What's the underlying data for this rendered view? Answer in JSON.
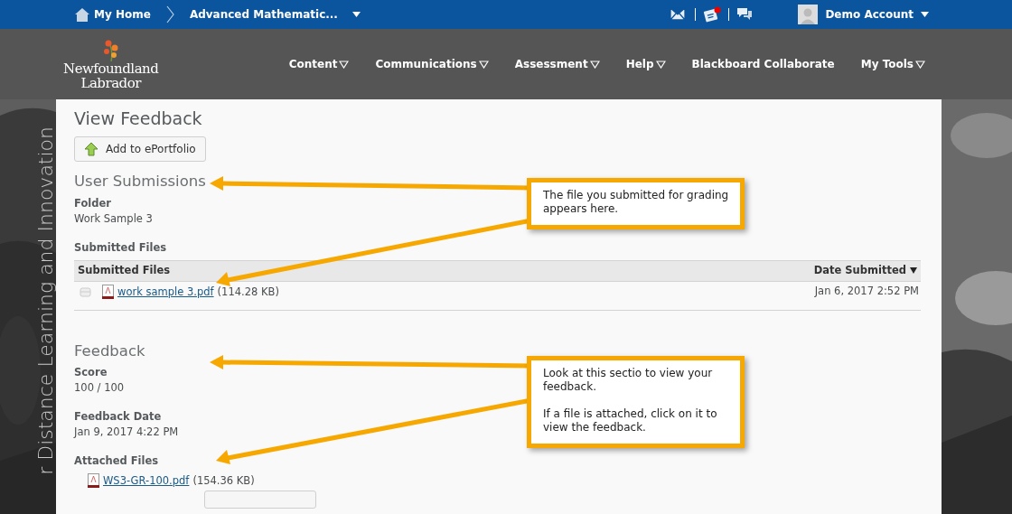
{
  "top_bar": {
    "home": "My Home",
    "course": "Advanced Mathematic...",
    "alerts": [
      {
        "kind": "mail",
        "unread": false
      },
      {
        "kind": "updates",
        "unread": true
      },
      {
        "kind": "chat",
        "unread": false
      }
    ],
    "account": "Demo Account"
  },
  "header": {
    "logo": [
      "Newfoundland",
      "Labrador"
    ],
    "nav": [
      {
        "label": "Content",
        "dropdown": true
      },
      {
        "label": "Communications",
        "dropdown": true
      },
      {
        "label": "Assessment",
        "dropdown": true
      },
      {
        "label": "Help",
        "dropdown": true
      },
      {
        "label": "Blackboard Collaborate",
        "dropdown": false
      },
      {
        "label": "My Tools",
        "dropdown": true
      }
    ]
  },
  "side_text": "r Distance Learning and Innovation",
  "page": {
    "title": "View Feedback",
    "portfolio_button": "Add to ePortfolio",
    "submissions": {
      "heading": "User Submissions",
      "folder_label": "Folder",
      "folder": "Work Sample 3",
      "files_label": "Submitted Files",
      "table": {
        "columns": [
          {
            "label": "Submitted Files",
            "sorted": false
          },
          {
            "label": "Date Submitted",
            "sorted": true
          }
        ],
        "rows": [
          {
            "file": "work sample 3.pdf",
            "size": "(114.28 KB)",
            "date": "Jan 6, 2017 2:52 PM"
          }
        ]
      }
    },
    "feedback": {
      "heading": "Feedback",
      "fields": [
        {
          "label": "Score",
          "value": "100 / 100"
        },
        {
          "label": "Feedback Date",
          "value": "Jan 9, 2017 4:22 PM"
        }
      ],
      "attached_label": "Attached Files",
      "files": [
        {
          "file": "WS3-GR-100.pdf",
          "size": "(154.36 KB)"
        }
      ]
    }
  },
  "callouts": [
    {
      "paragraphs": [
        "The file you submitted for grading appears here."
      ]
    },
    {
      "paragraphs": [
        "Look at this sectio to view your feedback.",
        "If a file is attached, click on it to view the feedback."
      ]
    }
  ]
}
